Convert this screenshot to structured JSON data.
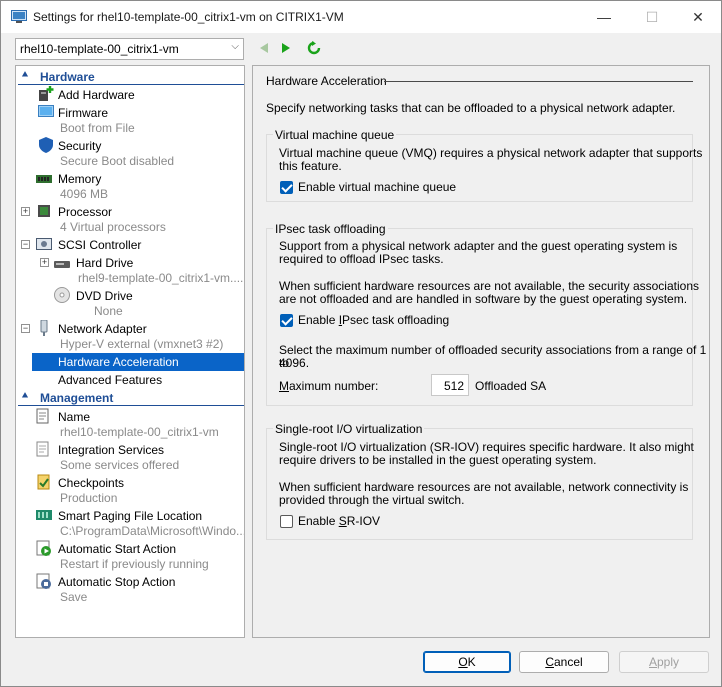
{
  "window": {
    "title": "Settings for rhel10-template-00_citrix1-vm on CITRIX1-VM",
    "minimize": "—",
    "maximize": "☐",
    "close": "✕"
  },
  "toolbar": {
    "vm_selected": "rhel10-template-00_citrix1-vm",
    "back_icon": "back-arrow-icon",
    "forward_icon": "forward-arrow-icon",
    "refresh_icon": "refresh-icon"
  },
  "tree": {
    "hardware_header": "Hardware",
    "management_header": "Management",
    "hardware_items": [
      {
        "name": "Add Hardware",
        "sub": ""
      },
      {
        "name": "Firmware",
        "sub": "Boot from File"
      },
      {
        "name": "Security",
        "sub": "Secure Boot disabled"
      },
      {
        "name": "Memory",
        "sub": "4096 MB"
      },
      {
        "name": "Processor",
        "sub": "4 Virtual processors"
      },
      {
        "name": "SCSI Controller",
        "sub": ""
      },
      {
        "name": "Hard Drive",
        "sub": "rhel9-template-00_citrix1-vm...."
      },
      {
        "name": "DVD Drive",
        "sub": "None"
      },
      {
        "name": "Network Adapter",
        "sub": "Hyper-V external (vmxnet3 #2)"
      },
      {
        "name": "Hardware Acceleration",
        "sub": ""
      },
      {
        "name": "Advanced Features",
        "sub": ""
      }
    ],
    "management_items": [
      {
        "name": "Name",
        "sub": "rhel10-template-00_citrix1-vm"
      },
      {
        "name": "Integration Services",
        "sub": "Some services offered"
      },
      {
        "name": "Checkpoints",
        "sub": "Production"
      },
      {
        "name": "Smart Paging File Location",
        "sub": "C:\\ProgramData\\Microsoft\\Windo..."
      },
      {
        "name": "Automatic Start Action",
        "sub": "Restart if previously running"
      },
      {
        "name": "Automatic Stop Action",
        "sub": "Save"
      }
    ]
  },
  "panel": {
    "title": "Hardware Acceleration",
    "intro": "Specify networking tasks that can be offloaded to a physical network adapter.",
    "vmq": {
      "title": "Virtual machine queue",
      "desc_line1": "Virtual machine queue (VMQ) requires a physical network adapter that supports",
      "desc_line2": "this feature.",
      "checkbox_label": "Enable virtual machine queue",
      "checked": true
    },
    "ipsec": {
      "title": "IPsec task offloading",
      "desc1_line1": "Support from a physical network adapter and the guest operating system is",
      "desc1_line2": "required to offload IPsec tasks.",
      "desc2_line1": "When sufficient hardware resources are not available, the security associations",
      "desc2_line2": "are not offloaded and are handled in software by the guest operating system.",
      "checkbox_label_pre": "Enable ",
      "checkbox_label_u": "I",
      "checkbox_label_post": "Psec task offloading",
      "checked": true,
      "range_line1": "Select the maximum number of offloaded security associations from a range of 1 to",
      "range_line2": "4096.",
      "max_label_u": "M",
      "max_label_rest": "aximum number:",
      "max_value": "512",
      "unit": "Offloaded SA"
    },
    "sriov": {
      "title": "Single-root I/O virtualization",
      "desc1_line1": "Single-root I/O virtualization (SR-IOV) requires specific hardware. It also might",
      "desc1_line2": "require drivers to be installed in the guest operating system.",
      "desc2_line1": "When sufficient hardware resources are not available, network connectivity is",
      "desc2_line2": "provided through the virtual switch.",
      "checkbox_label_pre": "Enable ",
      "checkbox_label_u": "S",
      "checkbox_label_post": "R-IOV",
      "checked": false
    }
  },
  "buttons": {
    "ok_u": "O",
    "ok_rest": "K",
    "cancel_u": "C",
    "cancel_rest": "ancel",
    "apply_pre": "",
    "apply_u": "A",
    "apply_rest": "pply"
  }
}
